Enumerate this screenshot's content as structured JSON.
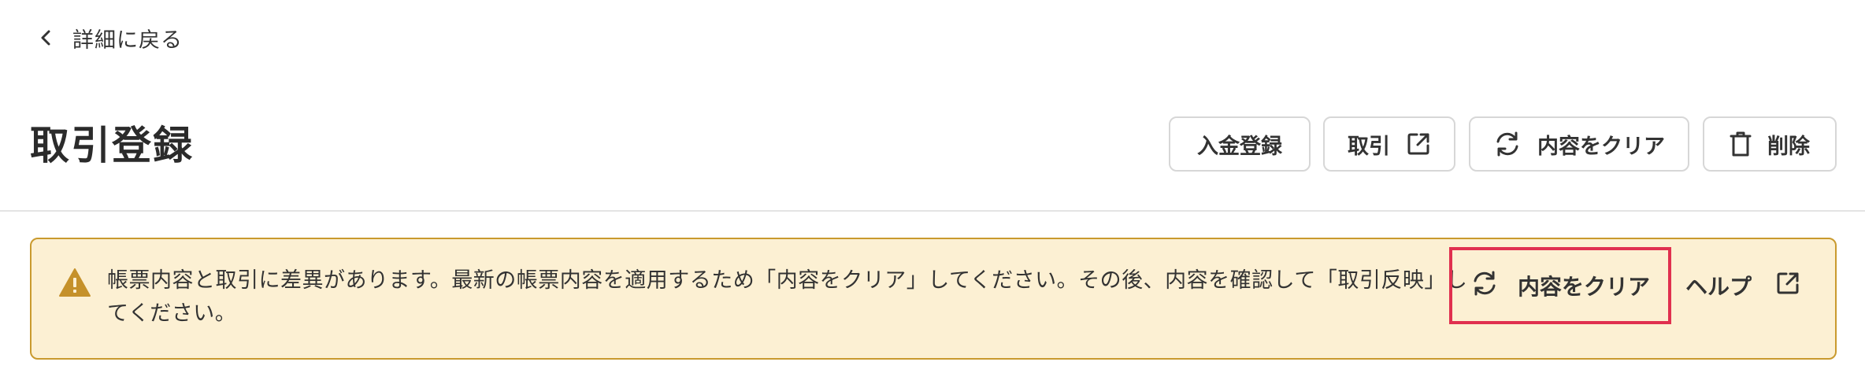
{
  "header": {
    "back_label": "詳細に戻る",
    "page_title": "取引登録"
  },
  "toolbar": {
    "deposit_label": "入金登録",
    "transaction_label": "取引",
    "clear_label": "内容をクリア",
    "delete_label": "削除"
  },
  "alert": {
    "message": "帳票内容と取引に差異があります。最新の帳票内容を適用するため「内容をクリア」してください。その後、内容を確認して「取引反映」してください。",
    "clear_label": "内容をクリア",
    "help_label": "ヘルプ"
  },
  "icons": {
    "back": "chevron-left-icon",
    "external": "external-link-icon",
    "refresh": "refresh-icon",
    "delete": "trash-icon",
    "warning": "warning-icon"
  },
  "colors": {
    "alert_background": "#fcf0d3",
    "alert_border": "#c99a2e",
    "warning_icon": "#c5912a",
    "highlight_border": "#e0304f",
    "text": "#333333"
  }
}
